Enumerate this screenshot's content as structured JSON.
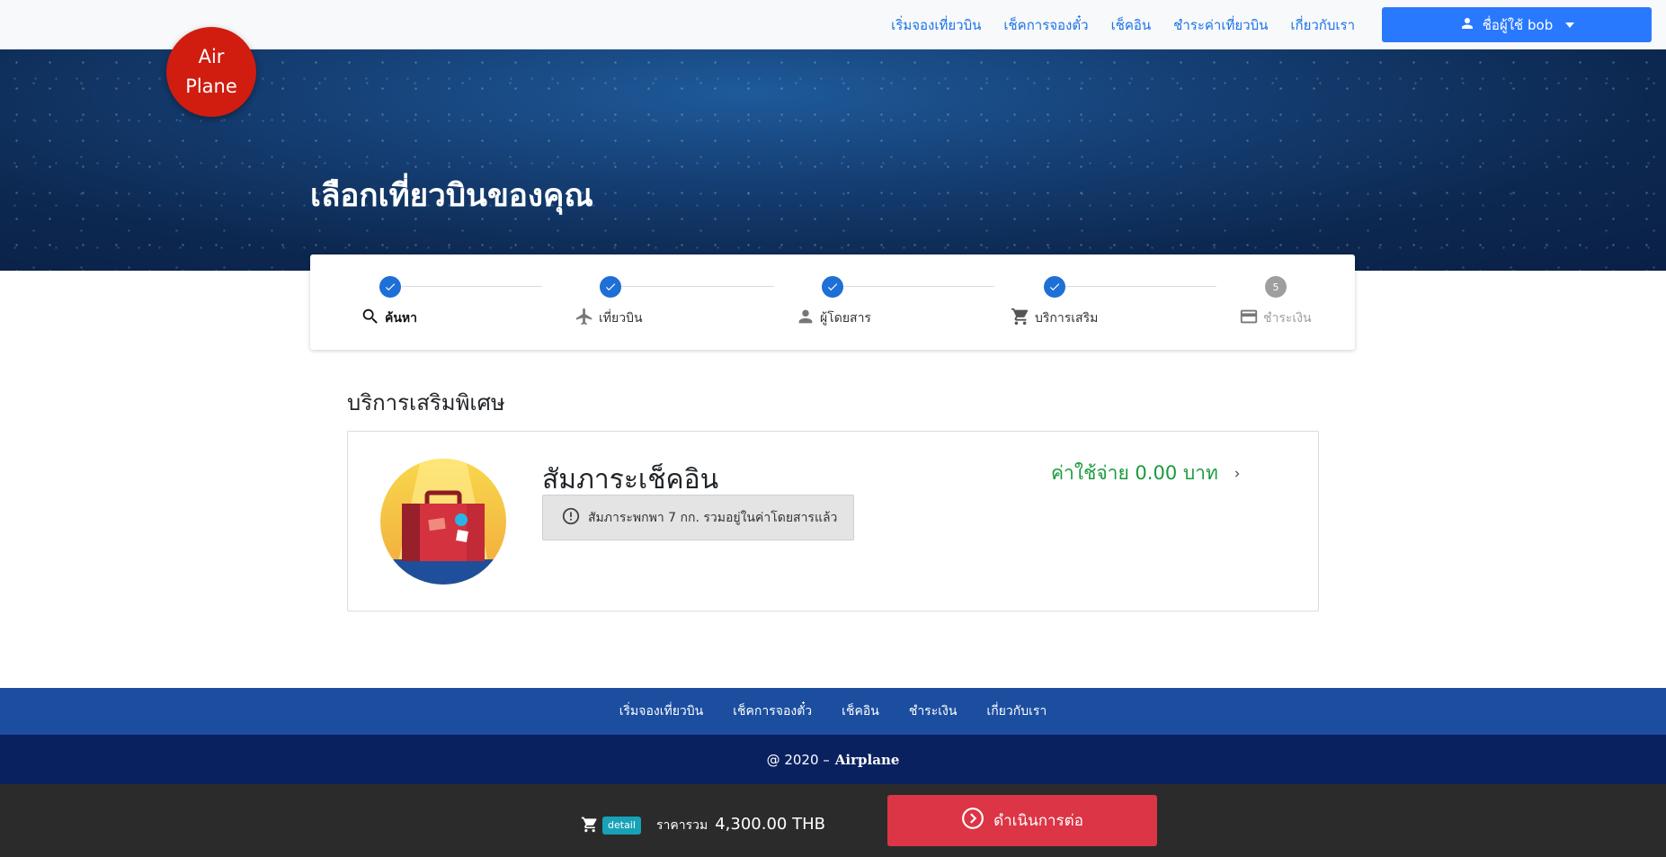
{
  "logo": {
    "line1": "Air",
    "line2": "Plane"
  },
  "nav": {
    "links": [
      "เริ่มจองเที่ยวบิน",
      "เช็คการจองตั๋ว",
      "เช็คอิน",
      "ชำระค่าเที่ยวบิน",
      "เกี่ยวกับเรา"
    ],
    "user_label": "ชื่อผู้ใช้ bob",
    "user_icon": "person-icon"
  },
  "hero": {
    "title": "เลือกเที่ยวบินของคุณ"
  },
  "stepper": {
    "steps": [
      {
        "label": "ค้นหา",
        "icon": "search-icon",
        "status": "done"
      },
      {
        "label": "เที่ยวบิน",
        "icon": "airplane-icon",
        "status": "done"
      },
      {
        "label": "ผู้โดยสาร",
        "icon": "person-icon",
        "status": "done"
      },
      {
        "label": "บริการเสริม",
        "icon": "cart-icon",
        "status": "done"
      },
      {
        "label": "ชำระเงิน",
        "icon": "credit-card-icon",
        "status": "pending",
        "number": "5"
      }
    ]
  },
  "section": {
    "title": "บริการเสริมพิเศษ"
  },
  "service_card": {
    "title": "สัมภาระเช็คอิน",
    "info": "สัมภาระพกพา 7 กก. รวมอยู่ในค่าโดยสารแล้ว",
    "price": "ค่าใช้จ่าย 0.00 บาท",
    "image_icon": "suitcase-icon"
  },
  "footer": {
    "links": [
      "เริ่มจองเที่ยวบิน",
      "เช็คการจองตั๋ว",
      "เช็คอิน",
      "ชำระเงิน",
      "เกี่ยวกับเรา"
    ],
    "copyright_prefix": "@ 2020 –",
    "copyright_brand": "Airplane"
  },
  "bottom_bar": {
    "detail_badge": "detail",
    "total_label": "ราคารวม",
    "total_value": "4,300.00 THB",
    "continue_label": "ดำเนินการต่อ"
  },
  "colors": {
    "primary": "#2979ff",
    "step_done": "#1e6fd6",
    "price_green": "#1a9b3e",
    "continue_red": "#dc3545",
    "logo_red": "#d01d10",
    "footer_blue": "#1c4ea0",
    "footer_dark": "#0a2160"
  }
}
